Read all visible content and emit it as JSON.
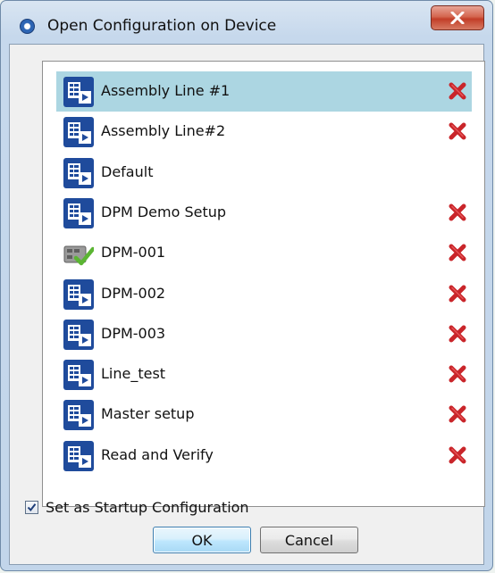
{
  "window": {
    "title": "Open Configuration on Device",
    "icons": {
      "app": "eye-app-icon",
      "close": "close-icon"
    }
  },
  "configs": [
    {
      "name": "Assembly Line #1",
      "icon": "config-file-icon",
      "deletable": true,
      "selected": true
    },
    {
      "name": "Assembly Line#2",
      "icon": "config-file-icon",
      "deletable": true,
      "selected": false
    },
    {
      "name": "Default",
      "icon": "config-file-icon",
      "deletable": false,
      "selected": false
    },
    {
      "name": "DPM Demo Setup",
      "icon": "config-file-icon",
      "deletable": true,
      "selected": false
    },
    {
      "name": "DPM-001",
      "icon": "active-config-icon",
      "deletable": true,
      "selected": false
    },
    {
      "name": "DPM-002",
      "icon": "config-file-icon",
      "deletable": true,
      "selected": false
    },
    {
      "name": "DPM-003",
      "icon": "config-file-icon",
      "deletable": true,
      "selected": false
    },
    {
      "name": "Line_test",
      "icon": "config-file-icon",
      "deletable": true,
      "selected": false
    },
    {
      "name": "Master setup",
      "icon": "config-file-icon",
      "deletable": true,
      "selected": false
    },
    {
      "name": "Read and Verify",
      "icon": "config-file-icon",
      "deletable": true,
      "selected": false
    }
  ],
  "startup": {
    "label": "Set as Startup Configuration",
    "checked": true
  },
  "buttons": {
    "ok": "OK",
    "cancel": "Cancel"
  },
  "colors": {
    "selection": "#acd6e2",
    "delete": "#c9252a",
    "config_icon": "#1f4b9c",
    "accent": "#3c7fb1"
  }
}
